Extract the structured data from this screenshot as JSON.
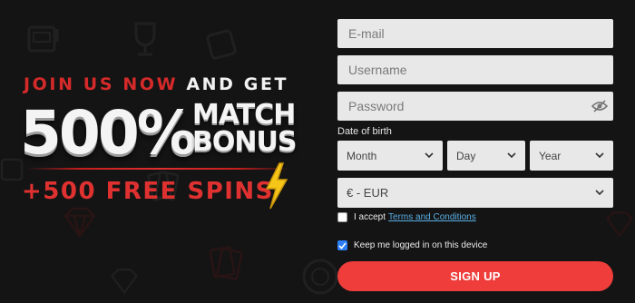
{
  "promo": {
    "line1_red": "JOIN US NOW",
    "line1_white": "AND GET",
    "bonus_percent": "500%",
    "match_line1": "MATCH",
    "match_line2": "BONUS",
    "free_spins": "+500 FREE SPINS"
  },
  "form": {
    "email_placeholder": "E-mail",
    "username_placeholder": "Username",
    "password_placeholder": "Password",
    "dob_label": "Date of birth",
    "month": "Month",
    "day": "Day",
    "year": "Year",
    "currency": "€ - EUR",
    "terms_prefix": "I accept",
    "terms_link": "Terms and Conditions",
    "terms_checked": false,
    "keep_logged_in": "Keep me logged in on this device",
    "keep_logged_in_checked": true,
    "signup_label": "SIGN UP"
  },
  "colors": {
    "background": "#141414",
    "accent_red": "#ee3d3b",
    "promo_red": "#d62a2a",
    "link_blue": "#5ab0e6",
    "checkbox_blue": "#2d7ff9",
    "field_bg": "#e8e8e8"
  },
  "icons": [
    "slot-machine-icon",
    "trophy-icon",
    "diamond-icon",
    "playing-cards-icon",
    "casino-chip-icon",
    "dice-icon",
    "lightning-bolt-icon",
    "eye-slash-icon",
    "chevron-down-icon",
    "checkmark-icon"
  ]
}
